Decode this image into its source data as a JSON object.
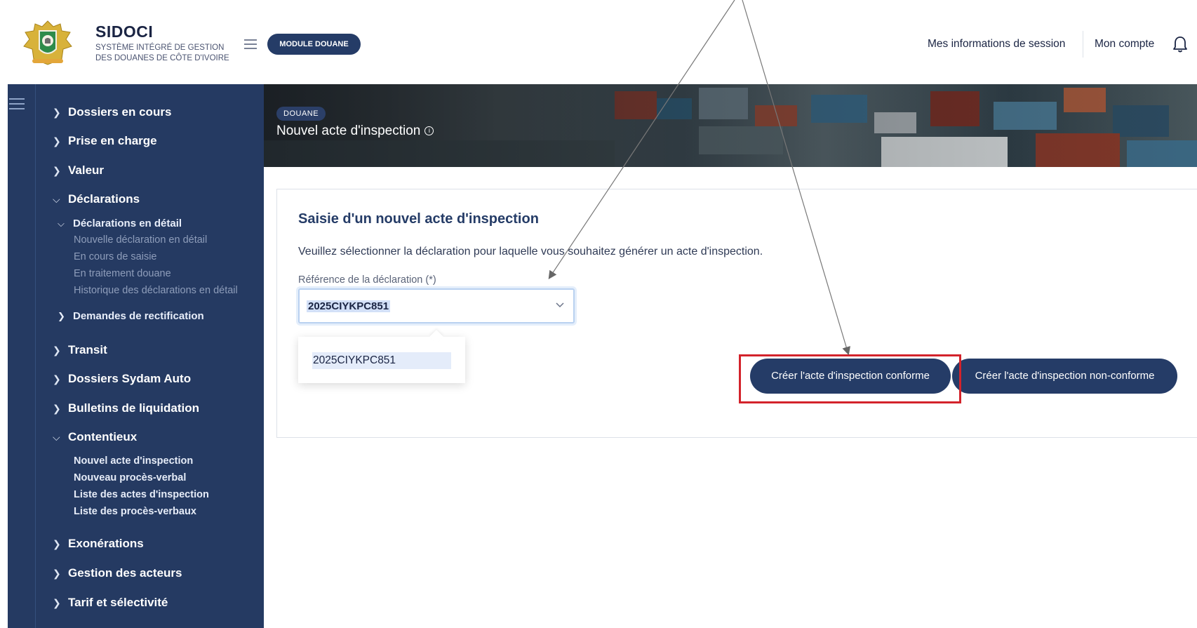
{
  "header": {
    "brand_name": "SIDOCI",
    "brand_sub_line1": "Système intégré de gestion",
    "brand_sub_line2": "des douanes de Côte d'Ivoire",
    "module_label": "MODULE DOUANE",
    "session_link": "Mes informations de session",
    "account_link": "Mon compte",
    "icons": [
      "menu-icon",
      "bell-icon",
      "coat-of-arms-logo"
    ]
  },
  "sidebar": {
    "items": [
      {
        "label": "Dossiers en cours",
        "state": "collapsed"
      },
      {
        "label": "Prise en charge",
        "state": "collapsed"
      },
      {
        "label": "Valeur",
        "state": "collapsed"
      },
      {
        "label": "Déclarations",
        "state": "expanded"
      },
      {
        "label": "Transit",
        "state": "collapsed"
      },
      {
        "label": "Dossiers Sydam Auto",
        "state": "collapsed"
      },
      {
        "label": "Bulletins de liquidation",
        "state": "collapsed"
      },
      {
        "label": "Contentieux",
        "state": "expanded"
      },
      {
        "label": "Exonérations",
        "state": "collapsed"
      },
      {
        "label": "Gestion des acteurs",
        "state": "collapsed"
      },
      {
        "label": "Tarif et sélectivité",
        "state": "collapsed"
      }
    ],
    "declarations_sub": {
      "group_label": "Déclarations en détail",
      "leaves": [
        "Nouvelle déclaration en détail",
        "En cours de saisie",
        "En traitement douane",
        "Historique des déclarations en détail"
      ],
      "rectif_label": "Demandes de rectification"
    },
    "contentieux_leaves": [
      "Nouvel acte d'inspection",
      "Nouveau procès-verbal",
      "Liste des actes d'inspection",
      "Liste des procès-verbaux"
    ]
  },
  "banner": {
    "badge": "DOUANE",
    "title": "Nouvel acte d'inspection"
  },
  "form": {
    "title": "Saisie d'un nouvel acte d'inspection",
    "description": "Veuillez sélectionner la déclaration pour laquelle vous souhaitez générer un acte d'inspection.",
    "field_label": "Référence de la déclaration (*)",
    "selected_value": "2025CIYKPC851",
    "options": [
      "2025CIYKPC851"
    ],
    "btn_conforme": "Créer l'acte d'inspection conforme",
    "btn_nonconforme": "Créer l'acte d'inspection non-conforme"
  },
  "colors": {
    "navy": "#253c67",
    "sidebar": "#253a62",
    "highlight": "#d3232b"
  }
}
